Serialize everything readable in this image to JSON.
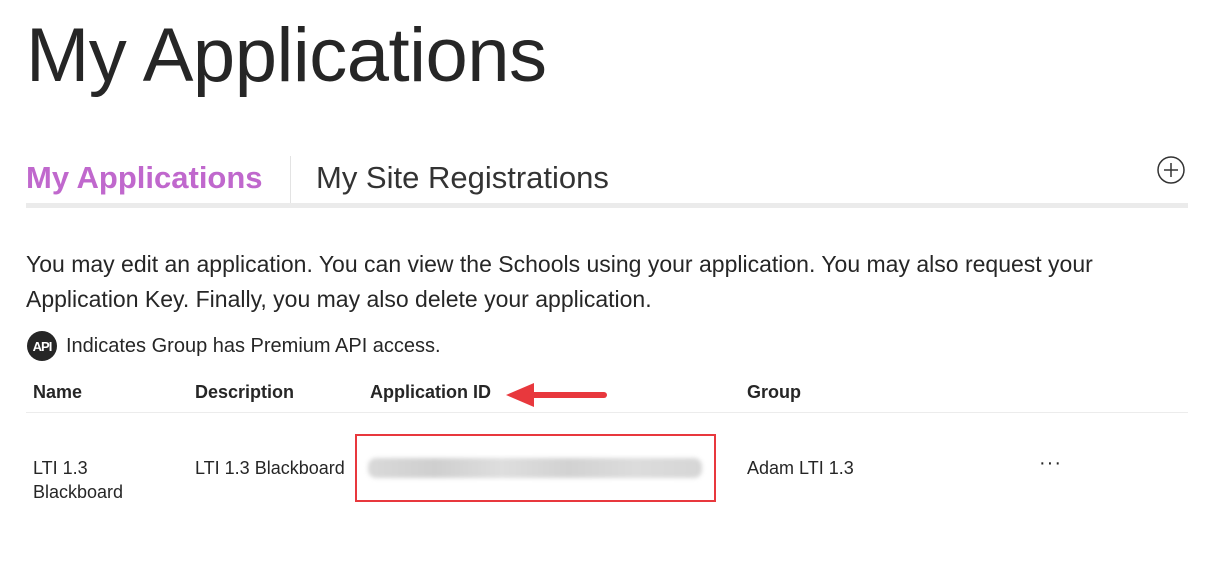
{
  "page": {
    "title": "My Applications"
  },
  "tabs": [
    {
      "label": "My Applications",
      "active": true
    },
    {
      "label": "My Site Registrations",
      "active": false
    }
  ],
  "add_icon": "plus-circle-icon",
  "description": "You may edit an application. You can view the Schools using your application. You may also request your Application Key. Finally, you may also delete your application.",
  "api_note": {
    "badge": "API",
    "text": "Indicates Group has Premium API access."
  },
  "table": {
    "columns": [
      "Name",
      "Description",
      "Application ID",
      "Group"
    ],
    "rows": [
      {
        "name_line1": "LTI 1.3",
        "name_line2": "Blackboard",
        "description": "LTI 1.3 Blackboard",
        "application_id": "",
        "group": "Adam LTI 1.3",
        "more": "···"
      }
    ]
  },
  "colors": {
    "accent": "#c068cd",
    "annotation": "#e8383d",
    "text": "#262626"
  }
}
